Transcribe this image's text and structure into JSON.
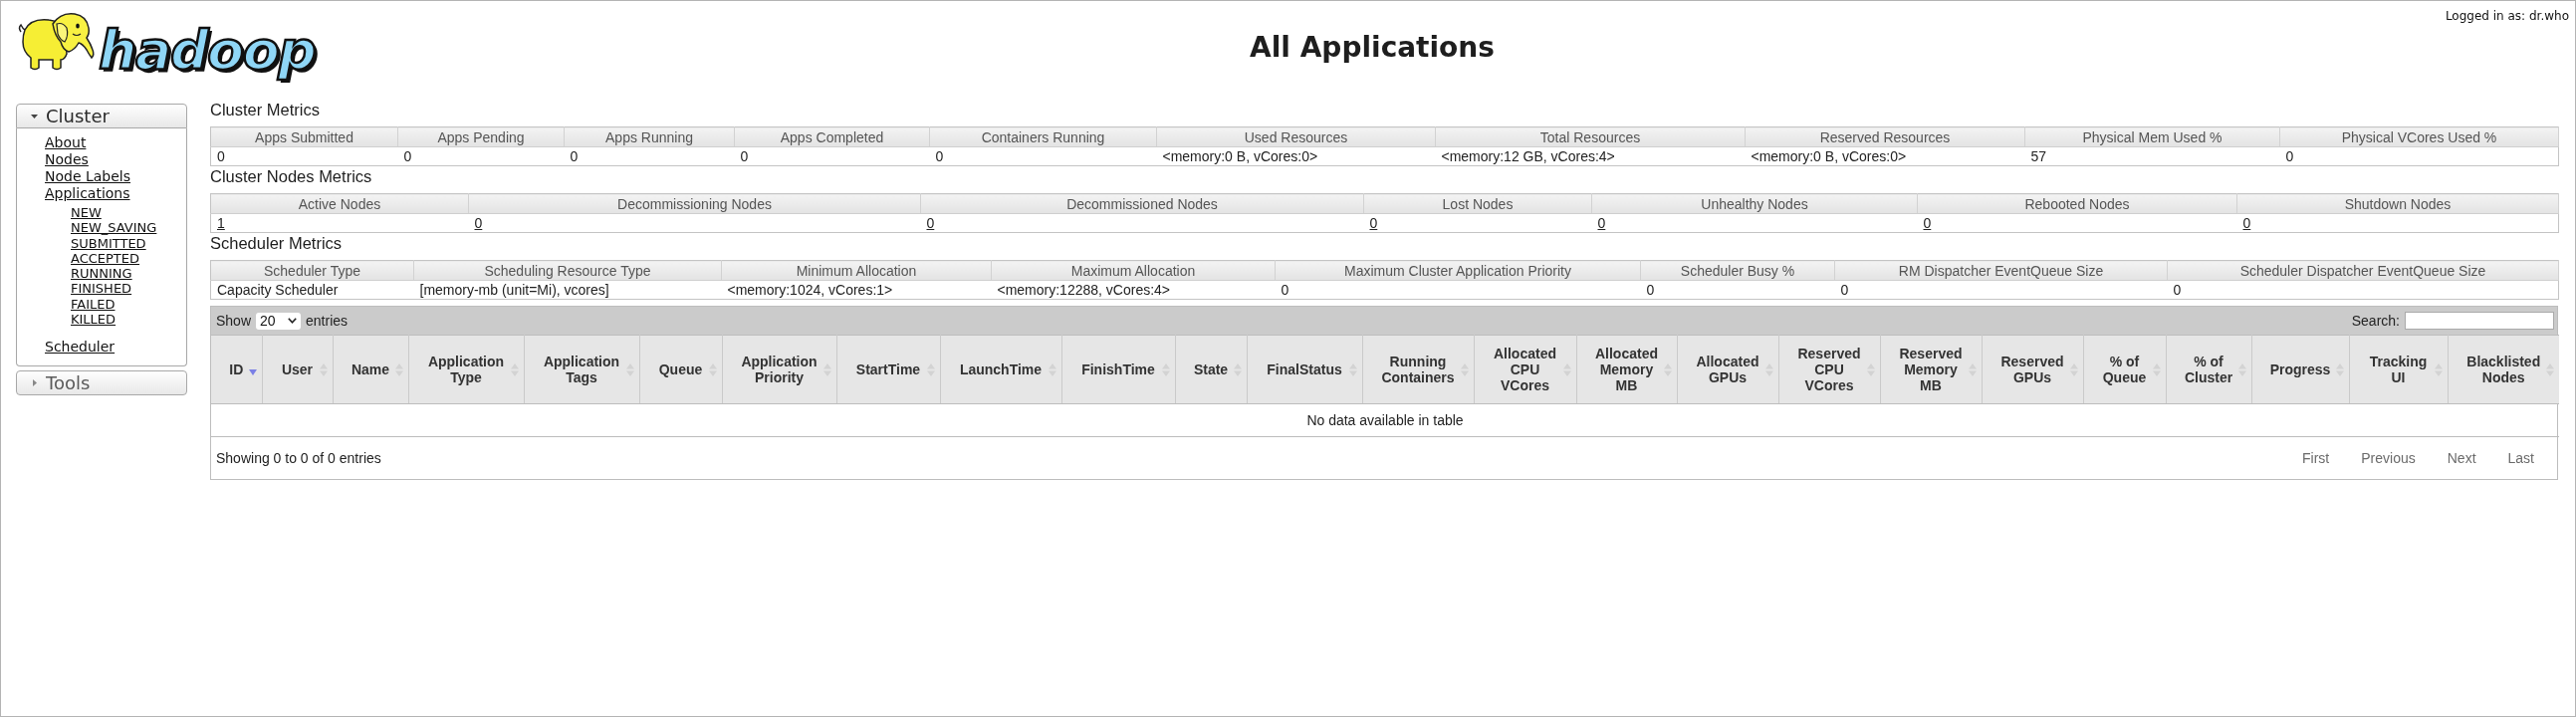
{
  "header": {
    "logo_text": "hadoop",
    "title": "All Applications",
    "user_label": "Logged in as: dr.who"
  },
  "sidebar": {
    "sections": [
      {
        "title": "Cluster",
        "expanded": true,
        "items": [
          {
            "label": "About"
          },
          {
            "label": "Nodes"
          },
          {
            "label": "Node Labels"
          },
          {
            "label": "Applications",
            "children": [
              {
                "label": "NEW"
              },
              {
                "label": "NEW_SAVING"
              },
              {
                "label": "SUBMITTED"
              },
              {
                "label": "ACCEPTED"
              },
              {
                "label": "RUNNING"
              },
              {
                "label": "FINISHED"
              },
              {
                "label": "FAILED"
              },
              {
                "label": "KILLED"
              }
            ]
          },
          {
            "label": "Scheduler"
          }
        ]
      },
      {
        "title": "Tools",
        "expanded": false
      }
    ]
  },
  "metrics": [
    {
      "title": "Cluster Metrics",
      "kind": "text",
      "columns": [
        "Apps Submitted",
        "Apps Pending",
        "Apps Running",
        "Apps Completed",
        "Containers Running",
        "Used Resources",
        "Total Resources",
        "Reserved Resources",
        "Physical Mem Used %",
        "Physical VCores Used %"
      ],
      "values": [
        "0",
        "0",
        "0",
        "0",
        "0",
        "<memory:0 B, vCores:0>",
        "<memory:12 GB, vCores:4>",
        "<memory:0 B, vCores:0>",
        "57",
        "0"
      ]
    },
    {
      "title": "Cluster Nodes Metrics",
      "kind": "links",
      "columns": [
        "Active Nodes",
        "Decommissioning Nodes",
        "Decommissioned Nodes",
        "Lost Nodes",
        "Unhealthy Nodes",
        "Rebooted Nodes",
        "Shutdown Nodes"
      ],
      "values": [
        "1",
        "0",
        "0",
        "0",
        "0",
        "0",
        "0"
      ]
    },
    {
      "title": "Scheduler Metrics",
      "kind": "text",
      "columns": [
        "Scheduler Type",
        "Scheduling Resource Type",
        "Minimum Allocation",
        "Maximum Allocation",
        "Maximum Cluster Application Priority",
        "Scheduler Busy %",
        "RM Dispatcher EventQueue Size",
        "Scheduler Dispatcher EventQueue Size"
      ],
      "values": [
        "Capacity Scheduler",
        "[memory-mb (unit=Mi), vcores]",
        "<memory:1024, vCores:1>",
        "<memory:12288, vCores:4>",
        "0",
        "0",
        "0",
        "0"
      ]
    }
  ],
  "applications": {
    "length_label": "Show",
    "page_length": "20",
    "length_suffix": "entries",
    "search_label": "Search:",
    "columns": [
      {
        "label": "ID",
        "sorted": true,
        "descending": true
      },
      {
        "label": "User",
        "sorted": false
      },
      {
        "label": "Name",
        "sorted": false
      },
      {
        "label": "Application Type",
        "sorted": false
      },
      {
        "label": "Application Tags",
        "sorted": false
      },
      {
        "label": "Queue",
        "sorted": false
      },
      {
        "label": "Application Priority",
        "sorted": false
      },
      {
        "label": "StartTime",
        "sorted": false
      },
      {
        "label": "LaunchTime",
        "sorted": false
      },
      {
        "label": "FinishTime",
        "sorted": false
      },
      {
        "label": "State",
        "sorted": false
      },
      {
        "label": "FinalStatus",
        "sorted": false
      },
      {
        "label": "Running Containers",
        "sorted": false
      },
      {
        "label": "Allocated CPU VCores",
        "sorted": false
      },
      {
        "label": "Allocated Memory MB",
        "sorted": false
      },
      {
        "label": "Allocated GPUs",
        "sorted": false
      },
      {
        "label": "Reserved CPU VCores",
        "sorted": false
      },
      {
        "label": "Reserved Memory MB",
        "sorted": false
      },
      {
        "label": "Reserved GPUs",
        "sorted": false
      },
      {
        "label": "% of Queue",
        "sorted": false
      },
      {
        "label": "% of Cluster",
        "sorted": false
      },
      {
        "label": "Progress",
        "sorted": false
      },
      {
        "label": "Tracking UI",
        "sorted": false
      },
      {
        "label": "Blacklisted Nodes",
        "sorted": false
      }
    ],
    "empty_message": "No data available in table",
    "info": "Showing 0 to 0 of 0 entries",
    "pager": [
      {
        "label": "First",
        "disabled": true
      },
      {
        "label": "Previous",
        "disabled": true
      },
      {
        "label": "Next",
        "disabled": true
      },
      {
        "label": "Last",
        "disabled": true
      }
    ]
  }
}
